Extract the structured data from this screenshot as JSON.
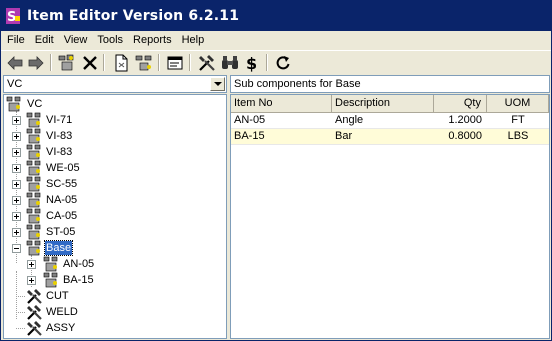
{
  "window": {
    "title": "Item Editor  Version 6.2.11"
  },
  "menu": [
    {
      "label": "File"
    },
    {
      "label": "Edit"
    },
    {
      "label": "View"
    },
    {
      "label": "Tools"
    },
    {
      "label": "Reports"
    },
    {
      "label": "Help"
    }
  ],
  "toolbar": {
    "buttons": [
      "back-arrow-icon",
      "forward-arrow-icon",
      "new-assembly-icon",
      "delete-x-icon",
      "new-document-icon",
      "assembly-tree-icon",
      "properties-icon",
      "tools-icon",
      "find-binoculars-icon",
      "cost-dollar-icon",
      "refresh-icon"
    ]
  },
  "tree_combo": {
    "value": "VC"
  },
  "tree": {
    "root": {
      "label": "VC"
    },
    "children": [
      {
        "label": "VI-71"
      },
      {
        "label": "VI-83"
      },
      {
        "label": "VI-83"
      },
      {
        "label": "WE-05"
      },
      {
        "label": "SC-55"
      },
      {
        "label": "NA-05"
      },
      {
        "label": "CA-05"
      },
      {
        "label": "ST-05"
      },
      {
        "label": "Base"
      }
    ],
    "base_children": [
      {
        "label": "AN-05"
      },
      {
        "label": "BA-15"
      }
    ],
    "operations": [
      {
        "label": "CUT"
      },
      {
        "label": "WELD"
      },
      {
        "label": "ASSY"
      }
    ]
  },
  "subcomponents": {
    "header": "Sub components for Base",
    "columns": [
      "Item No",
      "Description",
      "Qty",
      "UOM"
    ],
    "rows": [
      {
        "item_no": "AN-05",
        "description": "Angle",
        "qty": "1.2000",
        "uom": "FT"
      },
      {
        "item_no": "BA-15",
        "description": "Bar",
        "qty": "0.8000",
        "uom": "LBS"
      }
    ]
  },
  "colors": {
    "titlebar": "#0A246A",
    "selection": "#316AC5",
    "window_bg": "#ECE9D8",
    "selected_row": "#FFFCD8"
  }
}
